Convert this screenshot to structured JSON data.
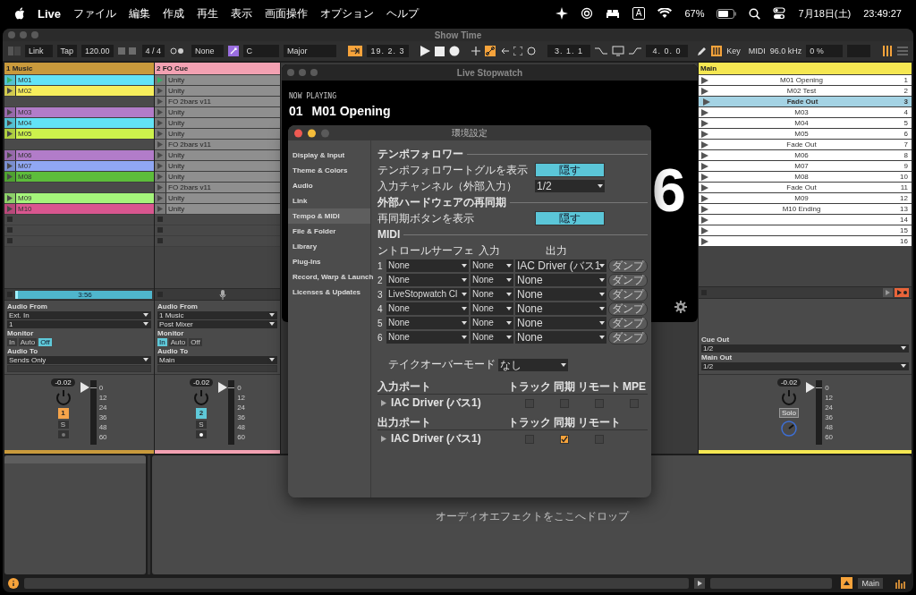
{
  "menu_bar": {
    "app": "Live",
    "items": [
      "ファイル",
      "編集",
      "作成",
      "再生",
      "表示",
      "画面操作",
      "オプション",
      "ヘルプ"
    ],
    "input_source": "A",
    "battery": "67%",
    "date": "7月18日(土)",
    "time": "23:49:27"
  },
  "window": {
    "title": "Show Time"
  },
  "toolbar": {
    "link": "Link",
    "tap": "Tap",
    "tempo": "120.00",
    "signature": "4 / 4",
    "quantize": "None",
    "key": "C",
    "scale": "Major",
    "position": "19. 2. 3",
    "loop_start": "3. 1. 1",
    "loop_length": "4. 0. 0",
    "key_map": "Key",
    "midi_map": "MIDI",
    "sample_rate": "96.0 kHz",
    "cpu": "0 %"
  },
  "tracks": [
    {
      "name": "1 Music",
      "color": "#c99a3c",
      "clips": [
        {
          "kind": "clip",
          "name": "M01",
          "color": "#62e3f6",
          "playing": true
        },
        {
          "kind": "clip",
          "name": "M02",
          "color": "#f7ee5c",
          "playing": false
        },
        {
          "kind": "empty"
        },
        {
          "kind": "clip",
          "name": "M03",
          "color": "#b27cc9",
          "playing": false
        },
        {
          "kind": "clip",
          "name": "M04",
          "color": "#62e3f6",
          "playing": false
        },
        {
          "kind": "clip",
          "name": "M05",
          "color": "#cdf24c",
          "playing": false
        },
        {
          "kind": "empty"
        },
        {
          "kind": "clip",
          "name": "M06",
          "color": "#b27cc9",
          "playing": false
        },
        {
          "kind": "clip",
          "name": "M07",
          "color": "#90a7f3",
          "playing": false
        },
        {
          "kind": "clip",
          "name": "M08",
          "color": "#5dbd3b",
          "playing": false
        },
        {
          "kind": "empty"
        },
        {
          "kind": "clip",
          "name": "M09",
          "color": "#a5f57b",
          "playing": false
        },
        {
          "kind": "clip",
          "name": "M10",
          "color": "#d9568f",
          "playing": false
        },
        {
          "kind": "stop"
        },
        {
          "kind": "stop"
        },
        {
          "kind": "stop"
        }
      ],
      "clip_time": "3:56",
      "audio_from_label": "Audio From",
      "audio_from": "Ext. In",
      "input_channel": "1",
      "monitor_label": "Monitor",
      "monitor": [
        {
          "label": "In",
          "selected": false
        },
        {
          "label": "Auto",
          "selected": false
        },
        {
          "label": "Off",
          "selected": true
        }
      ],
      "audio_to_label": "Audio To",
      "audio_to": "Sends Only",
      "volume": "-0.02",
      "number_button": {
        "label": "1",
        "color": "#f5a44a"
      },
      "solo": "S",
      "armed": false,
      "meter_scale": [
        "0",
        "12",
        "24",
        "36",
        "48",
        "60"
      ]
    },
    {
      "name": "2 FO Cue",
      "color": "#f3a1b2",
      "clips": [
        {
          "kind": "clip",
          "name": "Unity",
          "color": "#8f8f8f",
          "playing": true
        },
        {
          "kind": "clip",
          "name": "Unity",
          "color": "#8f8f8f",
          "playing": false
        },
        {
          "kind": "clip",
          "name": "FO 2bars v11",
          "color": "#8f8f8f",
          "playing": false
        },
        {
          "kind": "clip",
          "name": "Unity",
          "color": "#8f8f8f",
          "playing": false
        },
        {
          "kind": "clip",
          "name": "Unity",
          "color": "#8f8f8f",
          "playing": false
        },
        {
          "kind": "clip",
          "name": "Unity",
          "color": "#8f8f8f",
          "playing": false
        },
        {
          "kind": "clip",
          "name": "FO 2bars v11",
          "color": "#8f8f8f",
          "playing": false
        },
        {
          "kind": "clip",
          "name": "Unity",
          "color": "#8f8f8f",
          "playing": false
        },
        {
          "kind": "clip",
          "name": "Unity",
          "color": "#8f8f8f",
          "playing": false
        },
        {
          "kind": "clip",
          "name": "Unity",
          "color": "#8f8f8f",
          "playing": false
        },
        {
          "kind": "clip",
          "name": "FO 2bars v11",
          "color": "#8f8f8f",
          "playing": false
        },
        {
          "kind": "clip",
          "name": "Unity",
          "color": "#8f8f8f",
          "playing": false
        },
        {
          "kind": "clip",
          "name": "Unity",
          "color": "#8f8f8f",
          "playing": false
        },
        {
          "kind": "stop"
        },
        {
          "kind": "stop"
        },
        {
          "kind": "stop"
        }
      ],
      "audio_from_label": "Audio From",
      "audio_from": "1 Music",
      "input_channel": "Post Mixer",
      "monitor_label": "Monitor",
      "monitor": [
        {
          "label": "In",
          "selected": true
        },
        {
          "label": "Auto",
          "selected": false
        },
        {
          "label": "Off",
          "selected": false
        }
      ],
      "audio_to_label": "Audio To",
      "audio_to": "Main",
      "volume": "-0.02",
      "number_button": {
        "label": "2",
        "color": "#5fc9d9"
      },
      "solo": "S",
      "armed": true,
      "meter_scale": [
        "0",
        "12",
        "24",
        "36",
        "48",
        "60"
      ]
    }
  ],
  "main": {
    "name": "Main",
    "color": "#f5e752",
    "scenes": [
      {
        "name": "M01 Opening",
        "number": "1",
        "selected": false
      },
      {
        "name": "M02 Test",
        "number": "2",
        "selected": false
      },
      {
        "name": "Fade Out",
        "number": "3",
        "selected": true
      },
      {
        "name": "M03",
        "number": "4",
        "selected": false
      },
      {
        "name": "M04",
        "number": "5",
        "selected": false
      },
      {
        "name": "M05",
        "number": "6",
        "selected": false
      },
      {
        "name": "Fade Out",
        "number": "7",
        "selected": false
      },
      {
        "name": "M06",
        "number": "8",
        "selected": false
      },
      {
        "name": "M07",
        "number": "9",
        "selected": false
      },
      {
        "name": "M08",
        "number": "10",
        "selected": false
      },
      {
        "name": "Fade Out",
        "number": "11",
        "selected": false
      },
      {
        "name": "M09",
        "number": "12",
        "selected": false
      },
      {
        "name": "M10 Ending",
        "number": "13",
        "selected": false
      },
      {
        "number": "14",
        "selected": false
      },
      {
        "number": "15",
        "selected": false
      },
      {
        "number": "16",
        "selected": false
      }
    ],
    "cue_out_label": "Cue Out",
    "cue_out": "1/2",
    "main_out_label": "Main Out",
    "main_out": "1/2",
    "volume": "-0.02",
    "solo": "Solo",
    "meter_scale": [
      "0",
      "12",
      "24",
      "36",
      "48",
      "60"
    ]
  },
  "stopwatch": {
    "title": "Live Stopwatch",
    "label": "NOW PLAYING",
    "number": "01",
    "track": "M01 Opening",
    "big_digit": "6"
  },
  "prefs": {
    "title": "環境設定",
    "sidebar": [
      {
        "label": "Display & Input",
        "selected": false
      },
      {
        "label": "Theme & Colors",
        "selected": false
      },
      {
        "label": "Audio",
        "selected": false
      },
      {
        "label": "Link",
        "selected": false
      },
      {
        "label": "Tempo & MIDI",
        "selected": true
      },
      {
        "label": "File & Folder",
        "selected": false
      },
      {
        "label": "Library",
        "selected": false
      },
      {
        "label": "Plug-Ins",
        "selected": false
      },
      {
        "label": "Record, Warp & Launch",
        "selected": false
      },
      {
        "label": "Licenses & Updates",
        "selected": false
      }
    ],
    "tempo_follower": {
      "heading": "テンポフォロワー",
      "toggle_label": "テンポフォロワートグルを表示",
      "toggle": "隠す",
      "channel_label": "入力チャンネル（外部入力）",
      "channel": "1/2"
    },
    "resync": {
      "heading": "外部ハードウェアの再同期",
      "label": "再同期ボタンを表示",
      "toggle": "隠す"
    },
    "midi": {
      "heading": "MIDI",
      "columns": [
        "ントロールサーフェ",
        "入力",
        "出力"
      ],
      "rows": [
        {
          "number": "1",
          "surface": "None",
          "input": "None",
          "output": "IAC Driver (バス1",
          "dump": "ダンプ"
        },
        {
          "number": "2",
          "surface": "None",
          "input": "None",
          "output": "None",
          "dump": "ダンプ"
        },
        {
          "number": "3",
          "surface": "LiveStopwatch Cl",
          "input": "None",
          "output": "None",
          "dump": "ダンプ"
        },
        {
          "number": "4",
          "surface": "None",
          "input": "None",
          "output": "None",
          "dump": "ダンプ"
        },
        {
          "number": "5",
          "surface": "None",
          "input": "None",
          "output": "None",
          "dump": "ダンプ"
        },
        {
          "number": "6",
          "surface": "None",
          "input": "None",
          "output": "None",
          "dump": "ダンプ"
        }
      ],
      "takeover_label": "テイクオーバーモード",
      "takeover": "なし"
    },
    "port_groups": [
      {
        "heading": "入力ポート",
        "columns": [
          "トラック",
          "同期",
          "リモート",
          "MPE"
        ],
        "port": "IAC Driver (バス1)",
        "checks": [
          {
            "checked": false
          },
          {
            "checked": false
          },
          {
            "checked": false
          },
          {
            "checked": false
          }
        ]
      },
      {
        "heading": "出力ポート",
        "columns": [
          "トラック",
          "同期",
          "リモート"
        ],
        "port": "IAC Driver (バス1)",
        "checks": [
          {
            "checked": false
          },
          {
            "checked": true
          },
          {
            "checked": false
          }
        ]
      }
    ]
  },
  "device_view": {
    "drop_hint": "オーディオエフェクトをここへドロップ"
  },
  "status_bar": {
    "main": "Main"
  }
}
